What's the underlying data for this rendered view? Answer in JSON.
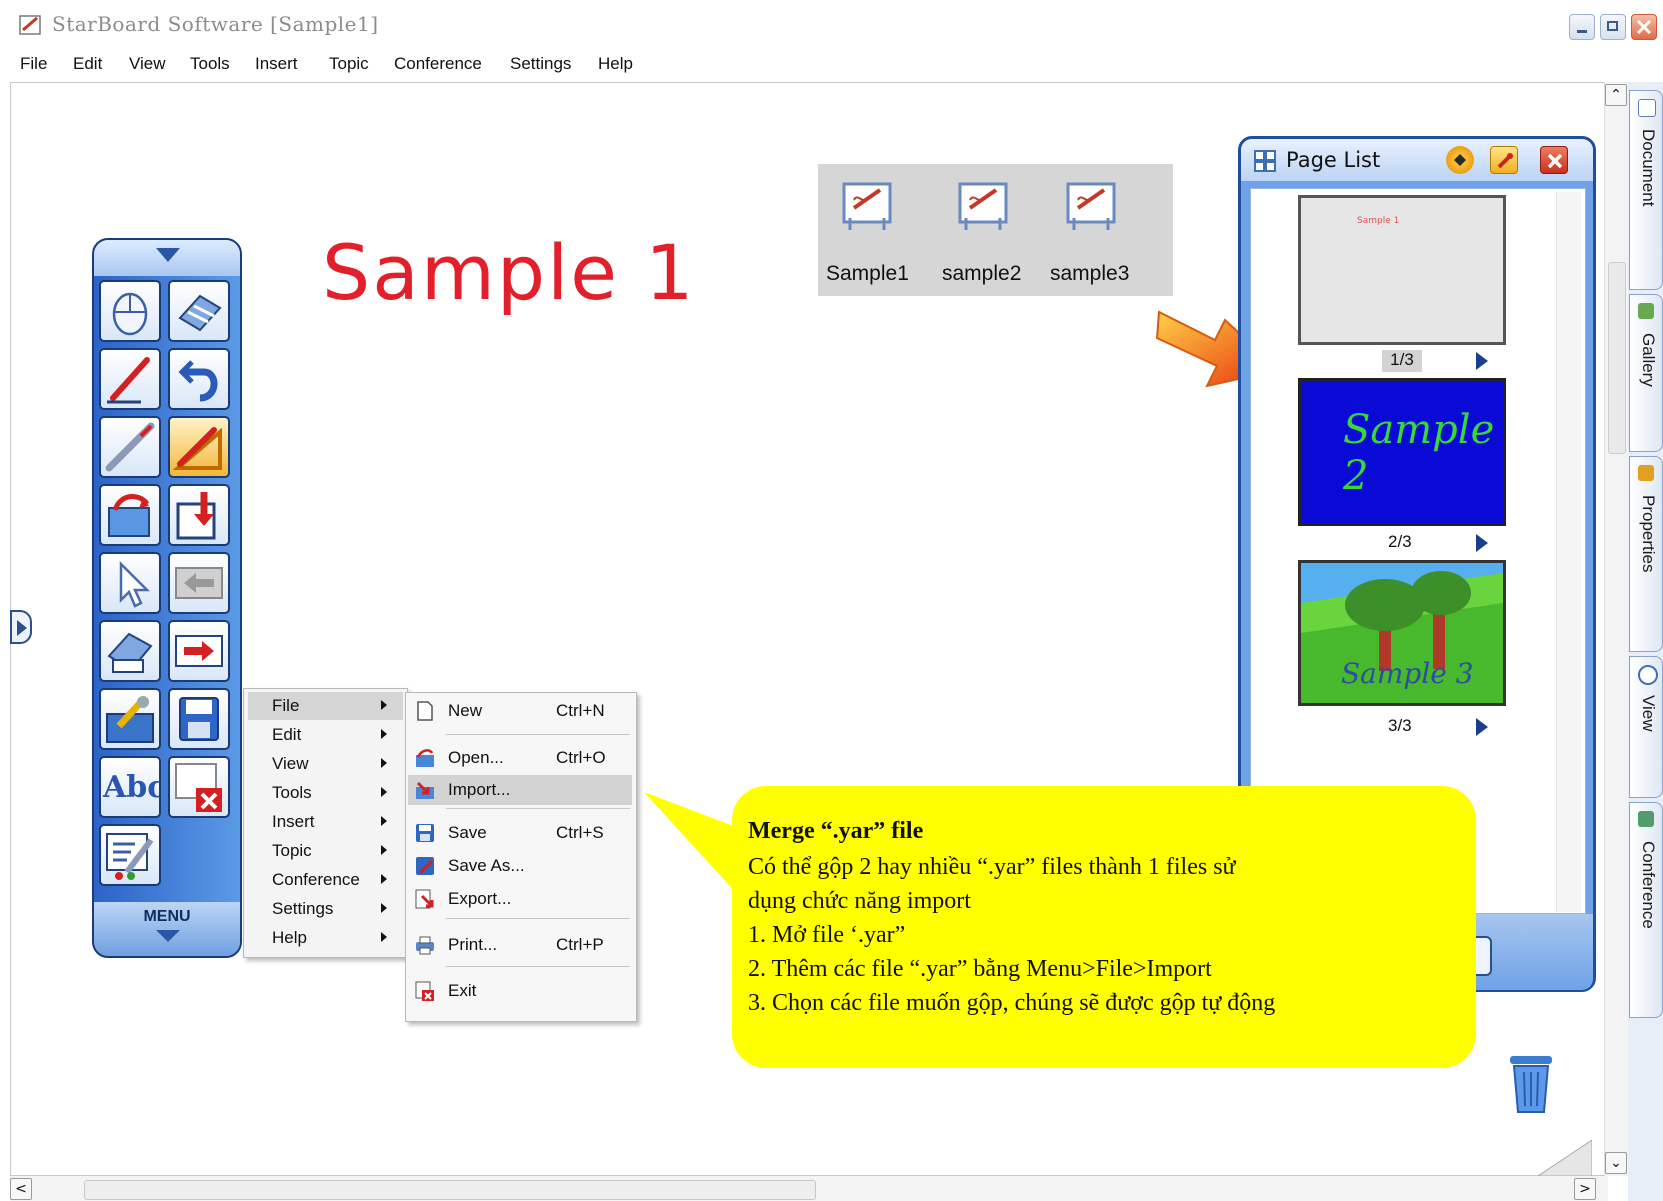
{
  "window": {
    "title": "StarBoard Software [Sample1]"
  },
  "menubar": {
    "items": [
      "File",
      "Edit",
      "View",
      "Tools",
      "Insert",
      "Topic",
      "Conference",
      "Settings",
      "Help"
    ]
  },
  "canvas": {
    "page_title": "Sample 1"
  },
  "toolbar": {
    "menu_label": "MENU",
    "abc_label": "Abc",
    "buttons": [
      "mouse-icon",
      "eraser-icon",
      "pen-icon",
      "undo-icon",
      "highlighter-icon",
      "shape-pen-icon",
      "open-icon",
      "insert-page-icon",
      "pointer-icon",
      "back-icon",
      "clear-icon",
      "next-icon",
      "tools-icon",
      "save-icon",
      "text-icon",
      "delete-icon",
      "customize-icon"
    ]
  },
  "file_strip": {
    "files": [
      "Sample1",
      "sample2",
      "sample3"
    ]
  },
  "page_list": {
    "title": "Page List",
    "pages": [
      {
        "label": "1/3",
        "thumb_text": "Sample 1",
        "background": "#e6e6e6"
      },
      {
        "label": "2/3",
        "thumb_text": "Sample 2",
        "background": "#0a0ad6"
      },
      {
        "label": "3/3",
        "thumb_text": "Sample 3",
        "background": "#55c83a"
      }
    ]
  },
  "context_menu": {
    "items": [
      "File",
      "Edit",
      "View",
      "Tools",
      "Insert",
      "Topic",
      "Conference",
      "Settings",
      "Help"
    ],
    "selected": "File"
  },
  "file_submenu": {
    "items": [
      {
        "label": "New",
        "shortcut": "Ctrl+N",
        "icon": "new-file-icon"
      },
      {
        "label": "Open...",
        "shortcut": "Ctrl+O",
        "icon": "open-folder-icon"
      },
      {
        "label": "Import...",
        "shortcut": "",
        "icon": "import-icon",
        "highlighted": true
      },
      {
        "label": "Save",
        "shortcut": "Ctrl+S",
        "icon": "save-icon"
      },
      {
        "label": "Save As...",
        "shortcut": "",
        "icon": "save-as-icon"
      },
      {
        "label": "Export...",
        "shortcut": "",
        "icon": "export-icon"
      },
      {
        "label": "Print...",
        "shortcut": "Ctrl+P",
        "icon": "print-icon"
      },
      {
        "label": "Exit",
        "shortcut": "",
        "icon": "exit-icon"
      }
    ]
  },
  "callout": {
    "title": "Merge “.yar” file",
    "lines": [
      "Có thể gộp 2 hay nhiều “.yar” files thành 1 files sử",
      "dụng chức năng import",
      "1. Mở file ‘.yar”",
      "2. Thêm các file “.yar” bằng Menu>File>Import",
      "3. Chọn các file muốn gộp, chúng sẽ được gộp tự động"
    ]
  },
  "side_tabs": [
    "Document",
    "Gallery",
    "Properties",
    "View",
    "Conference"
  ],
  "colors": {
    "accent": "#1f4e9a",
    "callout": "#ffff00",
    "title_red": "#e21f2a",
    "toolbar_blue": "#2c63c8"
  }
}
